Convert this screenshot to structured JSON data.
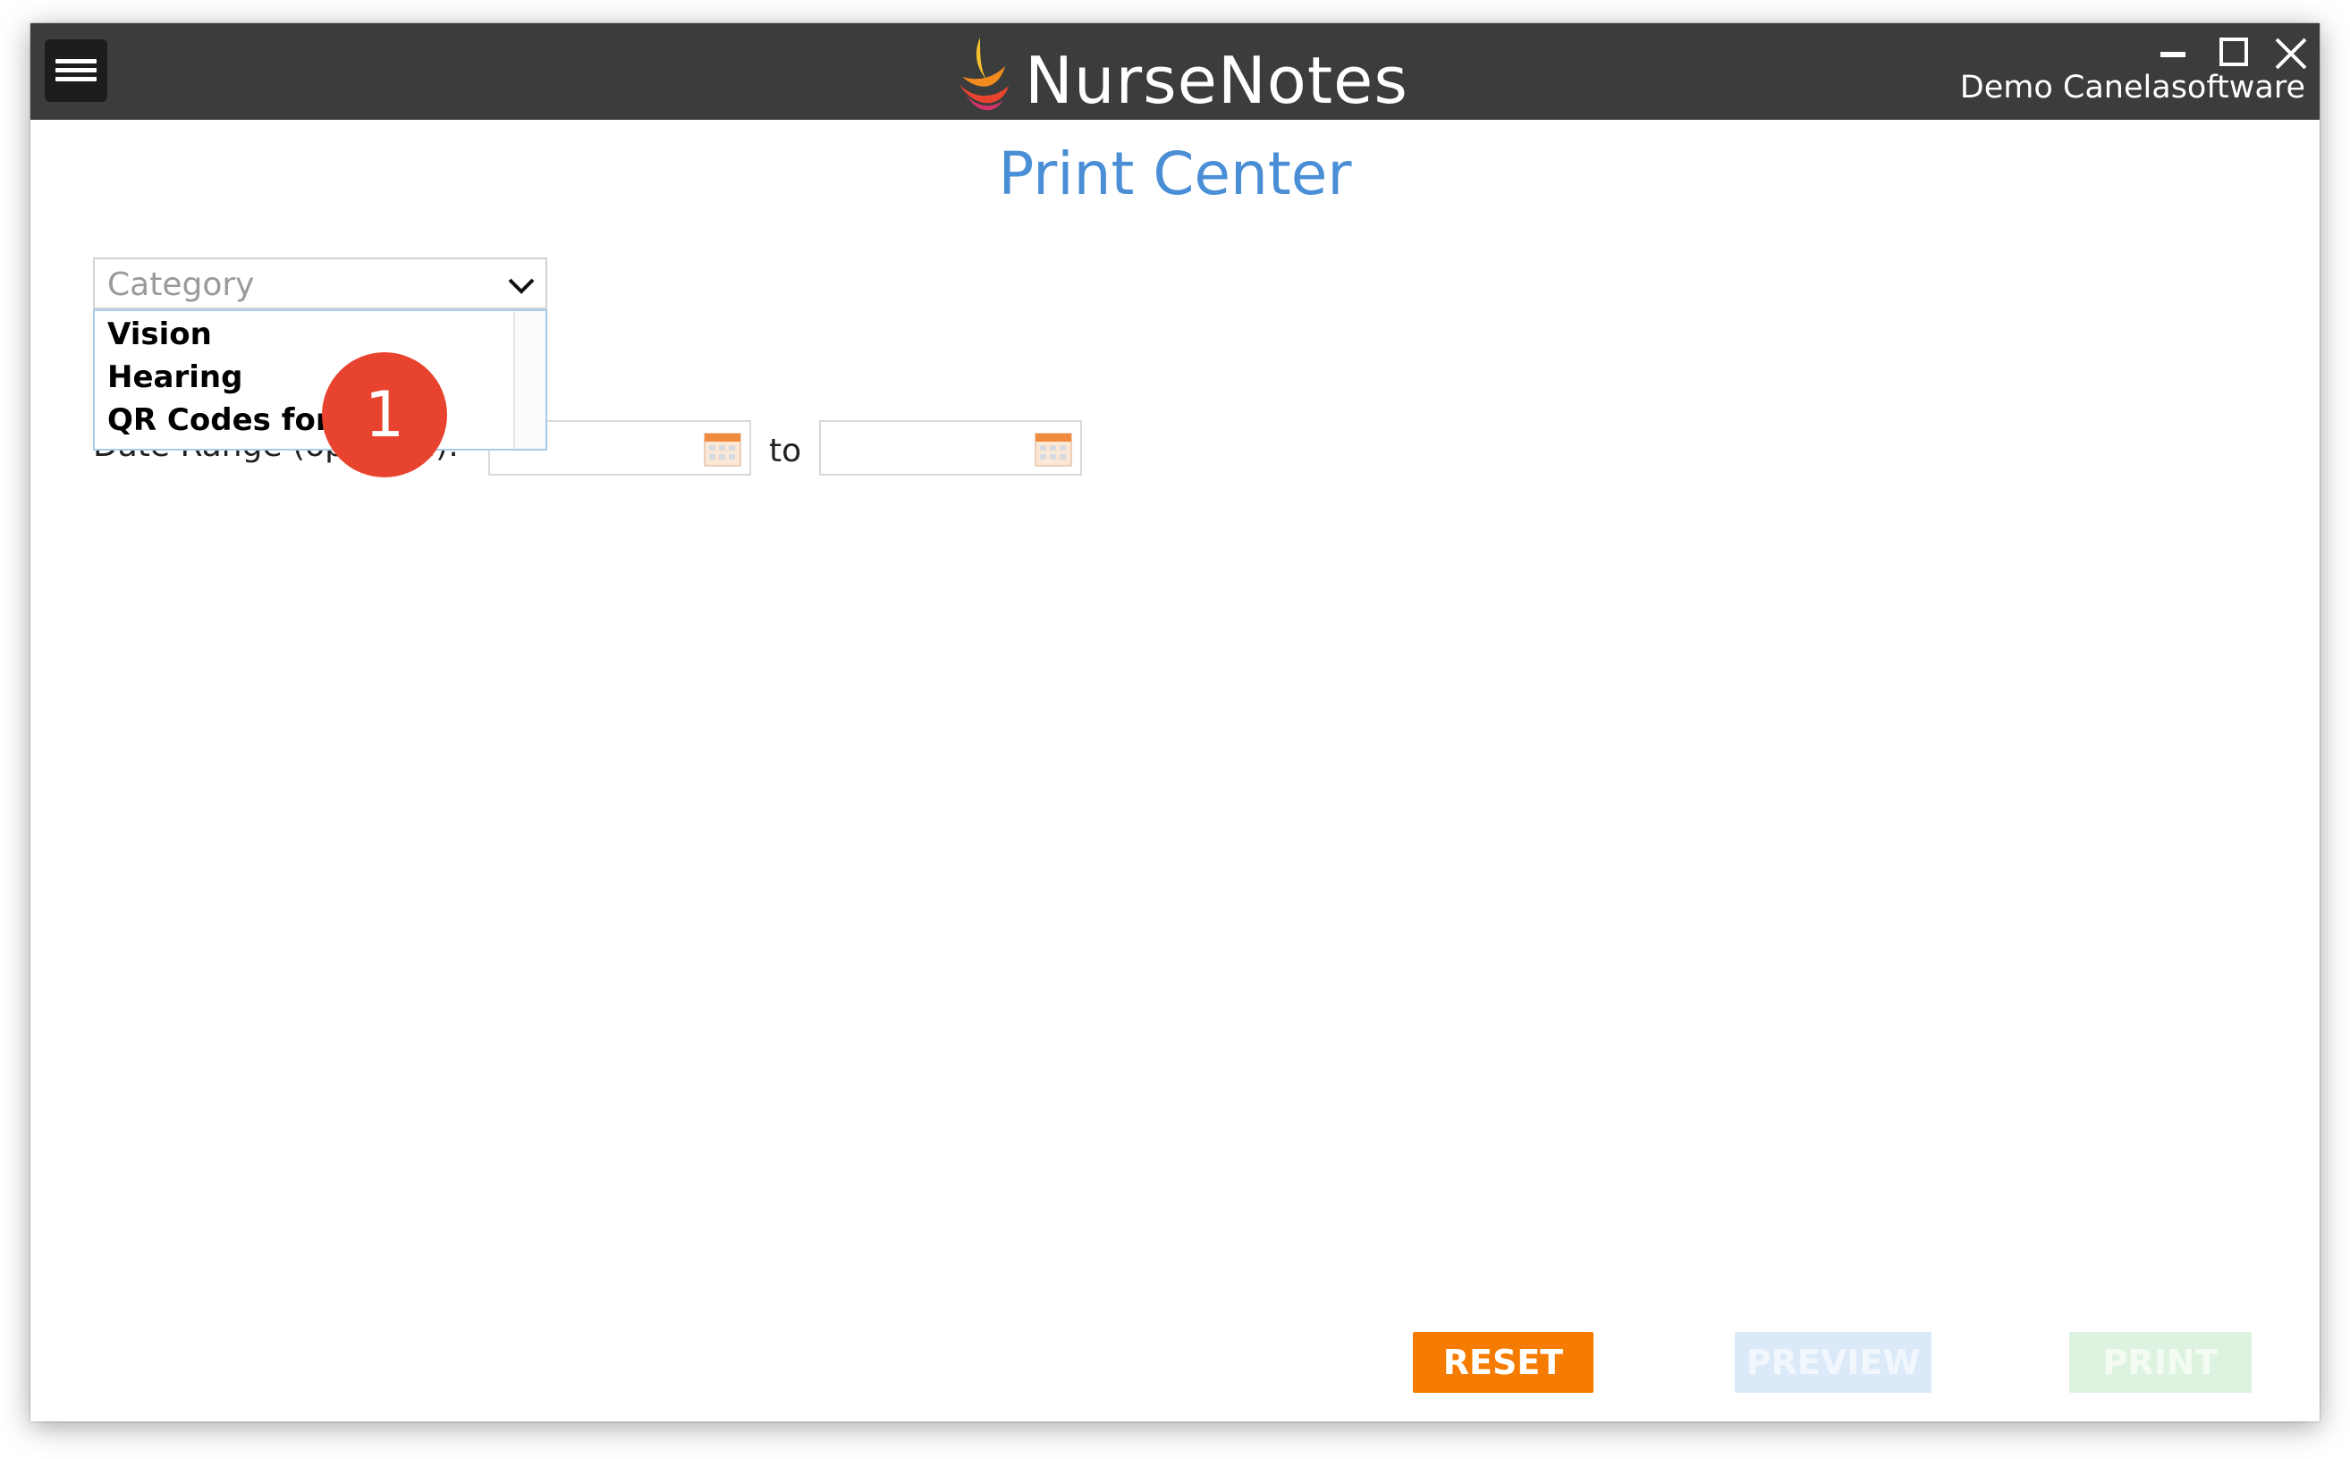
{
  "app": {
    "title": "NurseNotes",
    "user": "Demo Canelasoftware"
  },
  "page": {
    "title": "Print Center"
  },
  "category": {
    "placeholder": "Category",
    "options": [
      "Vision",
      "Hearing",
      "QR Codes for S"
    ]
  },
  "date_range": {
    "label": "Date Range (optional):",
    "to_label": "to"
  },
  "badge": {
    "number": "1"
  },
  "buttons": {
    "reset": "RESET",
    "preview": "PREVIEW",
    "print": "PRINT"
  },
  "colors": {
    "titlebar": "#3a3d3b",
    "page_title": "#4a8fd6",
    "reset": "#f57c00",
    "preview_disabled": "#dbe9f8",
    "print_disabled": "#def3df",
    "badge": "#e8432e"
  },
  "icons": {
    "menu": "hamburger-menu-icon",
    "minimize": "minimize-icon",
    "maximize": "maximize-icon",
    "close": "close-icon",
    "dropdown": "chevron-down-icon",
    "calendar": "calendar-icon"
  }
}
